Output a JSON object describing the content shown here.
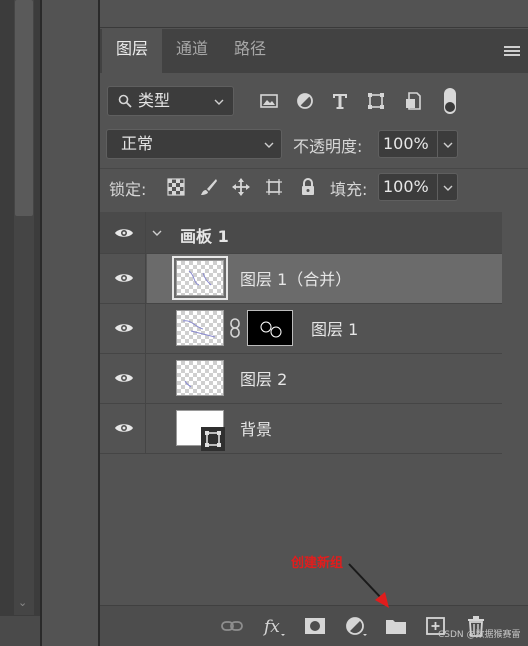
{
  "tabs": [
    "图层",
    "通道",
    "路径"
  ],
  "filter": {
    "label": "类型"
  },
  "blend_mode": "正常",
  "opacity": {
    "label": "不透明度:",
    "value": "100%"
  },
  "lock": {
    "label": "锁定:"
  },
  "fill": {
    "label": "填充:",
    "value": "100%"
  },
  "layers": [
    {
      "name": "画板 1"
    },
    {
      "name": "图层 1（合并）"
    },
    {
      "name": "图层 1"
    },
    {
      "name": "图层 2"
    },
    {
      "name": "背景"
    }
  ],
  "annotation": {
    "text": "创建新组",
    "color": "#e11d1d"
  },
  "watermark": "CSDN @数据猴赛雷",
  "icons": {
    "filter": [
      "image-filter-icon",
      "adjustment-filter-icon",
      "text-filter-icon",
      "shape-filter-icon",
      "smart-object-filter-icon",
      "filter-toggle-icon"
    ],
    "lock": [
      "lock-transparent-icon",
      "lock-image-icon",
      "lock-position-icon",
      "lock-artboard-icon",
      "lock-all-icon"
    ],
    "bottom": [
      "link-layers-icon",
      "layer-style-icon",
      "add-mask-icon",
      "adjustment-layer-icon",
      "new-group-icon",
      "new-layer-icon",
      "delete-layer-icon"
    ]
  },
  "colors": {
    "panel": "#535353",
    "selected_row": "#6b6b6b",
    "annotation": "#e11d1d"
  }
}
